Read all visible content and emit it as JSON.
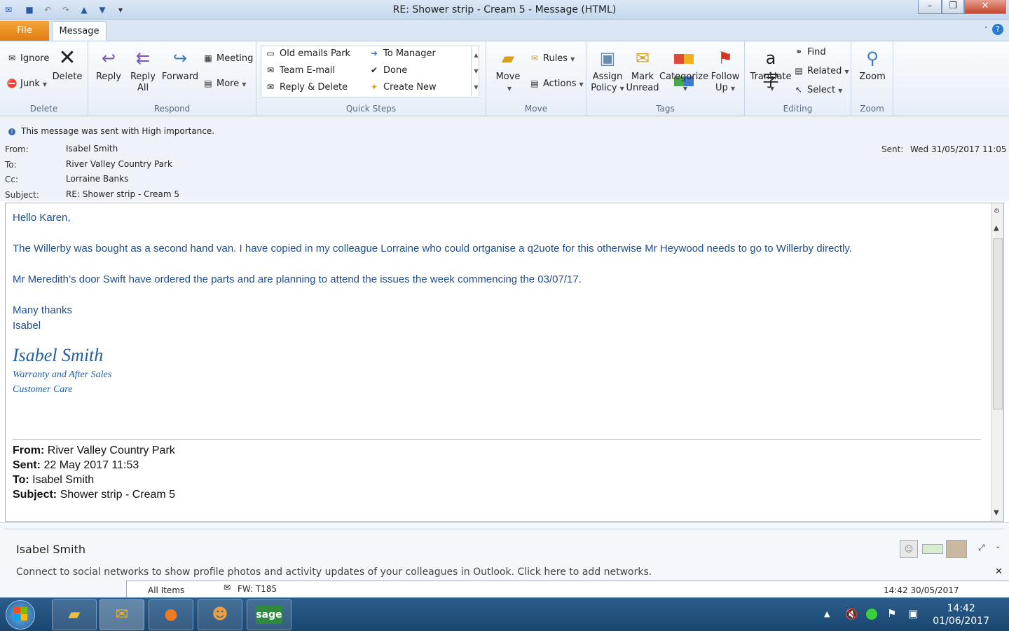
{
  "window": {
    "title": "RE: Shower strip - Cream 5  -  Message (HTML)"
  },
  "tabs": {
    "file": "File",
    "message": "Message"
  },
  "ribbon": {
    "delete_group": {
      "label": "Delete",
      "ignore": "Ignore",
      "junk": "Junk",
      "delete": "Delete"
    },
    "respond_group": {
      "label": "Respond",
      "reply": "Reply",
      "reply_all_1": "Reply",
      "reply_all_2": "All",
      "forward": "Forward",
      "meeting": "Meeting",
      "more": "More"
    },
    "quick_steps": {
      "label": "Quick Steps",
      "items": [
        "Old emails Park",
        "Team E-mail",
        "Reply & Delete",
        "To Manager",
        "Done",
        "Create New"
      ]
    },
    "move_group": {
      "label": "Move",
      "move": "Move",
      "rules": "Rules",
      "actions": "Actions"
    },
    "tags_group": {
      "label": "Tags",
      "assign_1": "Assign",
      "assign_2": "Policy",
      "mark_1": "Mark",
      "mark_2": "Unread",
      "categorize": "Categorize",
      "follow_1": "Follow",
      "follow_2": "Up"
    },
    "editing_group": {
      "label": "Editing",
      "translate": "Translate",
      "find": "Find",
      "related": "Related",
      "select": "Select"
    },
    "zoom_group": {
      "label": "Zoom",
      "zoom": "Zoom"
    }
  },
  "info_bar": "This message was sent with High importance.",
  "headers": {
    "from_label": "From:",
    "from": "Isabel Smith",
    "to_label": "To:",
    "to": "River Valley Country Park",
    "cc_label": "Cc:",
    "cc": "Lorraine Banks",
    "subject_label": "Subject:",
    "subject": "RE: Shower strip - Cream 5",
    "sent_label": "Sent:",
    "sent": "Wed 31/05/2017 11:05"
  },
  "body": {
    "greeting": "Hello Karen,",
    "p1": "The Willerby was bought as a second hand van. I have copied in my colleague Lorraine who could ortganise a q2uote for this otherwise Mr Heywood needs to go to Willerby directly.",
    "p2": "Mr Meredith’s door Swift have ordered the parts and are planning to attend the issues the week commencing the 03/07/17.",
    "thanks": "Many thanks",
    "name": "Isabel",
    "sig_name": "Isabel Smith",
    "sig_line1": "Warranty and After Sales",
    "sig_line2": "Customer Care"
  },
  "forwarded": {
    "from_label": "From:",
    "from": "River Valley Country Park",
    "sent_label": "Sent:",
    "sent": "22 May 2017 11:53",
    "to_label": "To:",
    "to": "Isabel Smith",
    "subject_label": "Subject:",
    "subject": "Shower strip - Cream 5"
  },
  "people_pane": {
    "name": "Isabel Smith",
    "message": "Connect to social networks to show profile photos and activity updates of your colleagues in Outlook. Click here to add networks.",
    "behind_folder": "All Items",
    "behind_subject": "FW: T185",
    "behind_time": "14:42 30/05/2017"
  },
  "taskbar": {
    "time": "14:42",
    "date": "01/06/2017"
  }
}
